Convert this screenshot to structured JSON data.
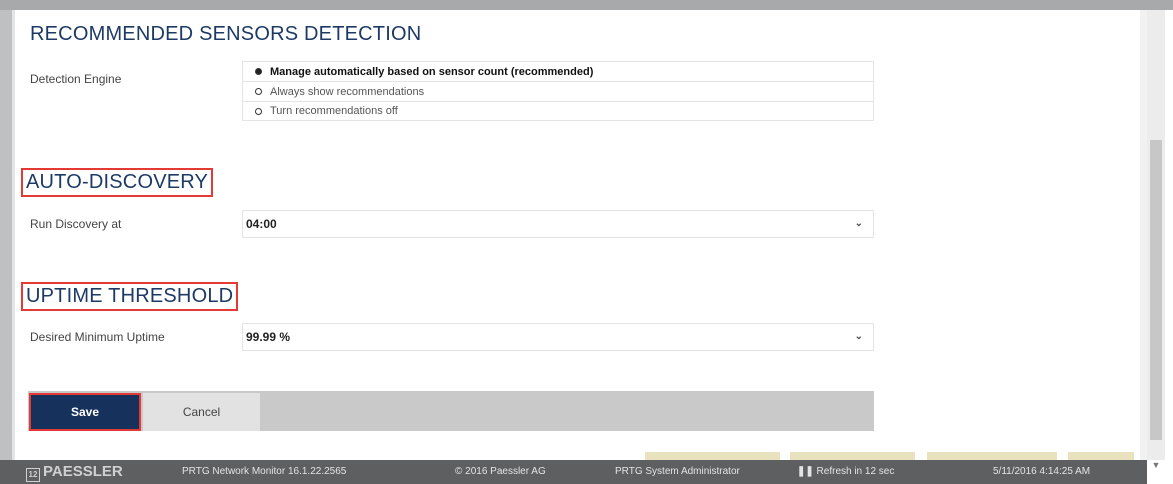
{
  "sections": {
    "recommended_sensors": {
      "title": "RECOMMENDED SENSORS DETECTION",
      "engine_label": "Detection Engine",
      "options": [
        "Manage automatically based on sensor count (recommended)",
        "Always show recommendations",
        "Turn recommendations off"
      ],
      "selected_option": "Manage automatically based on sensor count (recommended)"
    },
    "auto_discovery": {
      "title": "AUTO-DISCOVERY",
      "run_label": "Run Discovery at",
      "run_value": "04:00"
    },
    "uptime_threshold": {
      "title": "UPTIME THRESHOLD",
      "uptime_label": "Desired Minimum Uptime",
      "uptime_value": "99.99 %"
    }
  },
  "buttons": {
    "save": "Save",
    "cancel": "Cancel"
  },
  "footer": {
    "logo": "PAESSLER",
    "product": "PRTG Network Monitor 16.1.22.2565",
    "copyright": "© 2016 Paessler AG",
    "user": "PRTG System Administrator",
    "refresh": "Refresh in 12 sec",
    "datetime": "5/11/2016 4:14:25 AM"
  },
  "icons": {
    "chevron": "chevron-down-icon",
    "pause": "pause-icon",
    "scroll_down": "scroll-down-arrow-icon"
  },
  "colors": {
    "heading": "#1d3a66",
    "save_button": "#16325c",
    "highlight_box": "#e53935",
    "footer_bg": "#5d5f61"
  }
}
